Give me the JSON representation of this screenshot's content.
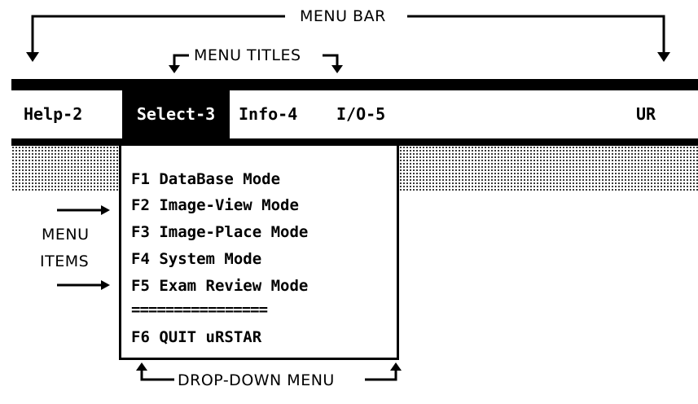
{
  "annotations": {
    "menu_bar": "MENU BAR",
    "menu_titles": "MENU TITLES",
    "menu_items_line1": "MENU",
    "menu_items_line2": "ITEMS",
    "drop_down_menu": "DROP-DOWN MENU"
  },
  "menubar": {
    "titles": [
      "Help-2",
      "Select-3",
      "Info-4",
      "I/O-5"
    ],
    "selected": "Select-3",
    "right_label": "UR"
  },
  "dropdown": {
    "items": [
      "F1 DataBase Mode",
      "F2 Image-View Mode",
      "F3 Image-Place Mode",
      "F4 System Mode",
      "F5 Exam Review Mode",
      "================",
      "F6 QUIT uRSTAR"
    ]
  }
}
